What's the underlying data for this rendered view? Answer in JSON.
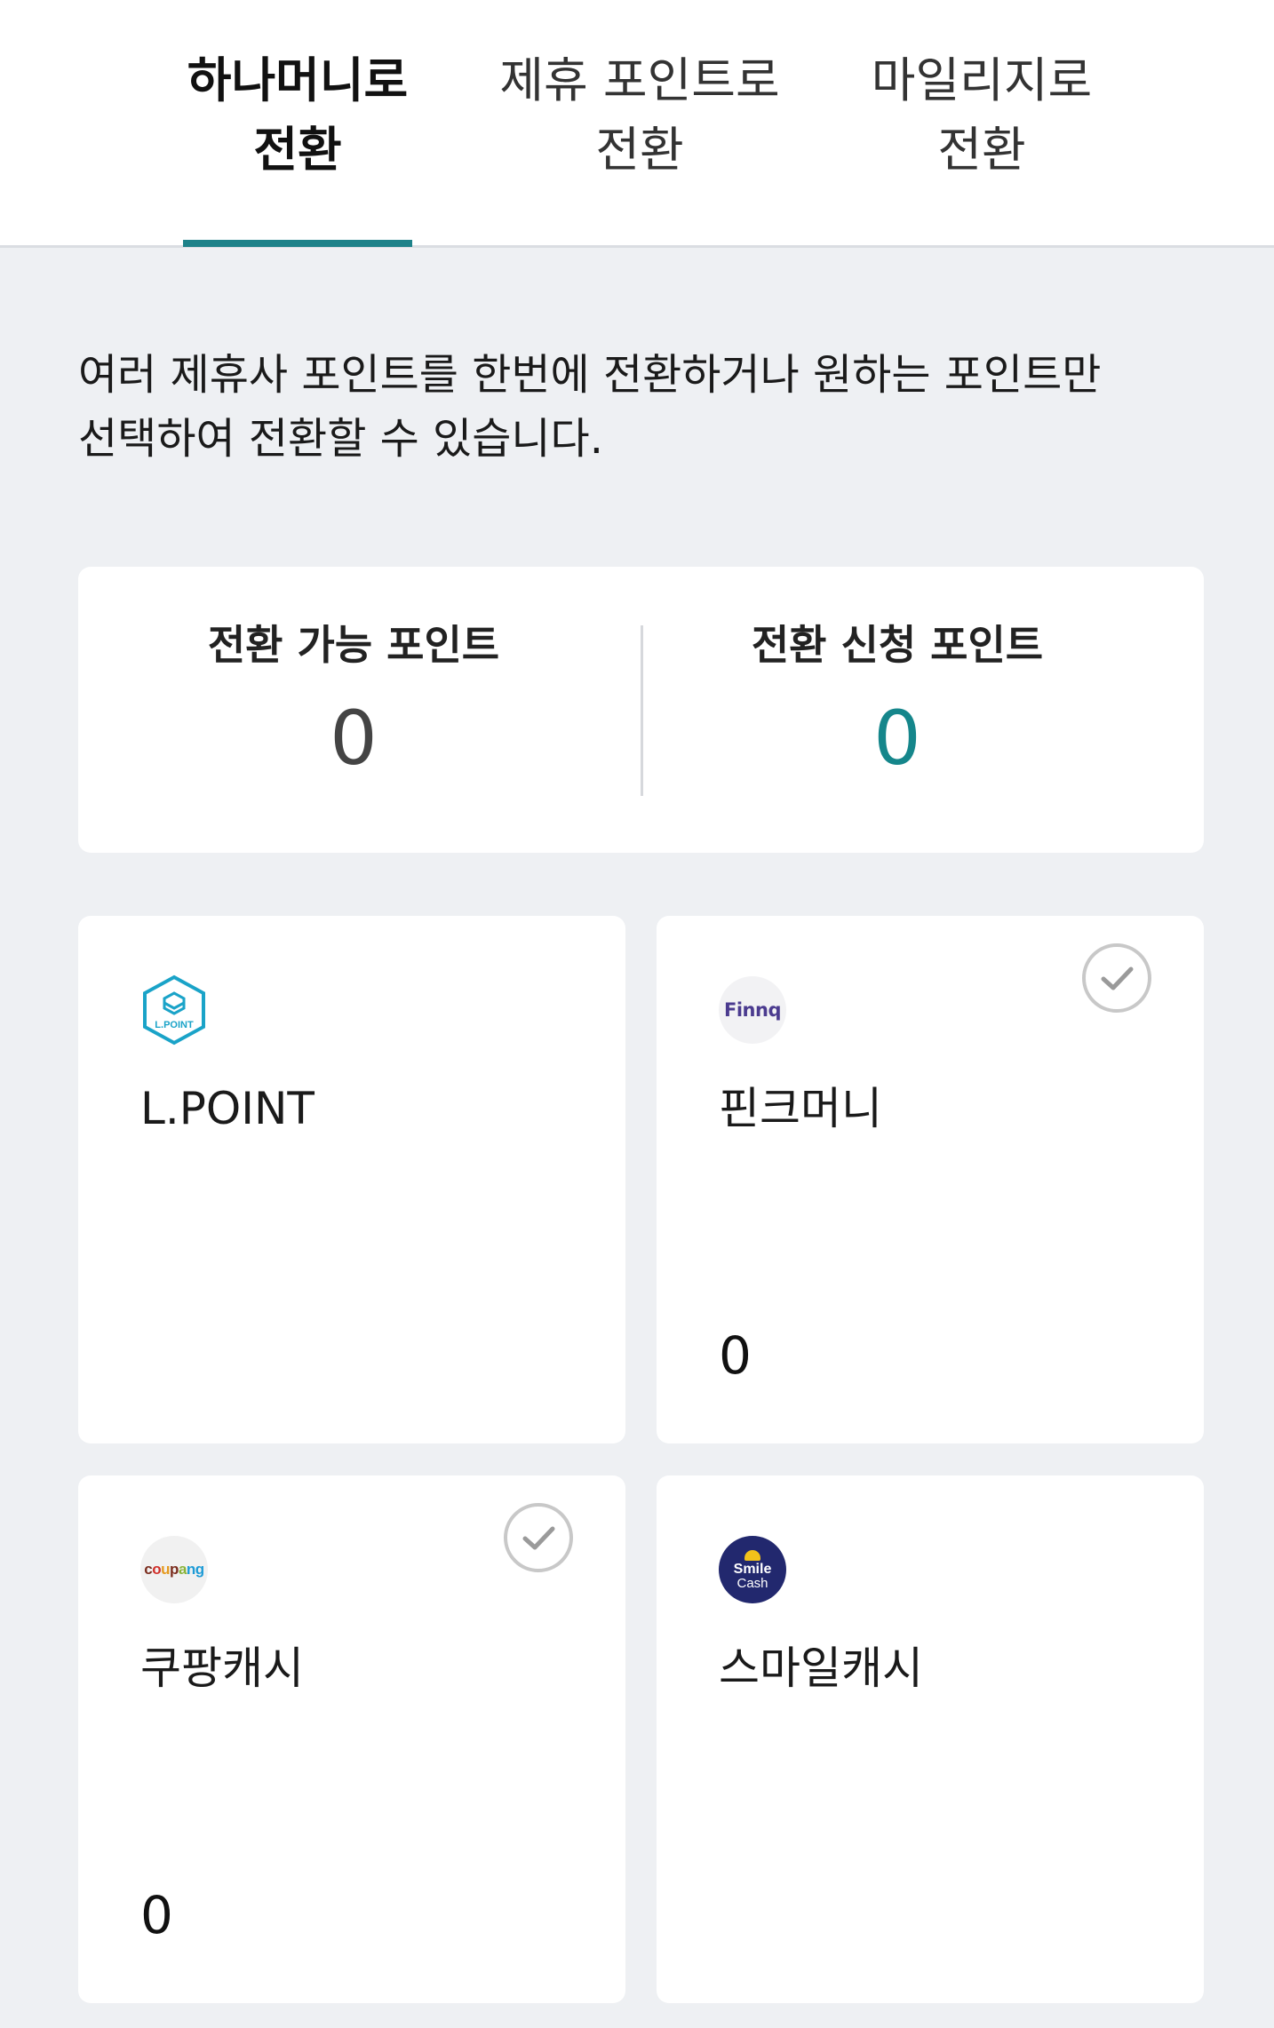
{
  "tabs": [
    {
      "line1": "하나머니로",
      "line2": "전환",
      "active": true
    },
    {
      "line1": "제휴 포인트로",
      "line2": "전환",
      "active": false
    },
    {
      "line1": "마일리지로",
      "line2": "전환",
      "active": false
    }
  ],
  "description": {
    "line1": "여러 제휴사 포인트를 한번에 전환하거나 원하는 포인트만",
    "line2": "선택하여 전환할 수 있습니다."
  },
  "summary": {
    "available_label": "전환 가능 포인트",
    "available_value": "0",
    "requested_label": "전환 신청 포인트",
    "requested_value": "0",
    "accent_color": "#15868b"
  },
  "partners": [
    {
      "name": "L.POINT",
      "amount": "",
      "logo_text": "L.POINT",
      "icon": "lpoint-logo-icon",
      "checkable": false
    },
    {
      "name": "핀크머니",
      "amount": "0",
      "logo_text": "Finnq",
      "icon": "finnq-logo-icon",
      "checkable": true
    },
    {
      "name": "쿠팡캐시",
      "amount": "0",
      "logo_text": "coupang",
      "icon": "coupang-logo-icon",
      "checkable": true
    },
    {
      "name": "스마일캐시",
      "amount": "",
      "logo_text_1": "Smile",
      "logo_text_2": "Cash",
      "icon": "smilecash-logo-icon",
      "checkable": false
    }
  ],
  "colors": {
    "tab_indicator": "#1e8289",
    "background": "#eef0f3",
    "smile_navy": "#22286e"
  }
}
